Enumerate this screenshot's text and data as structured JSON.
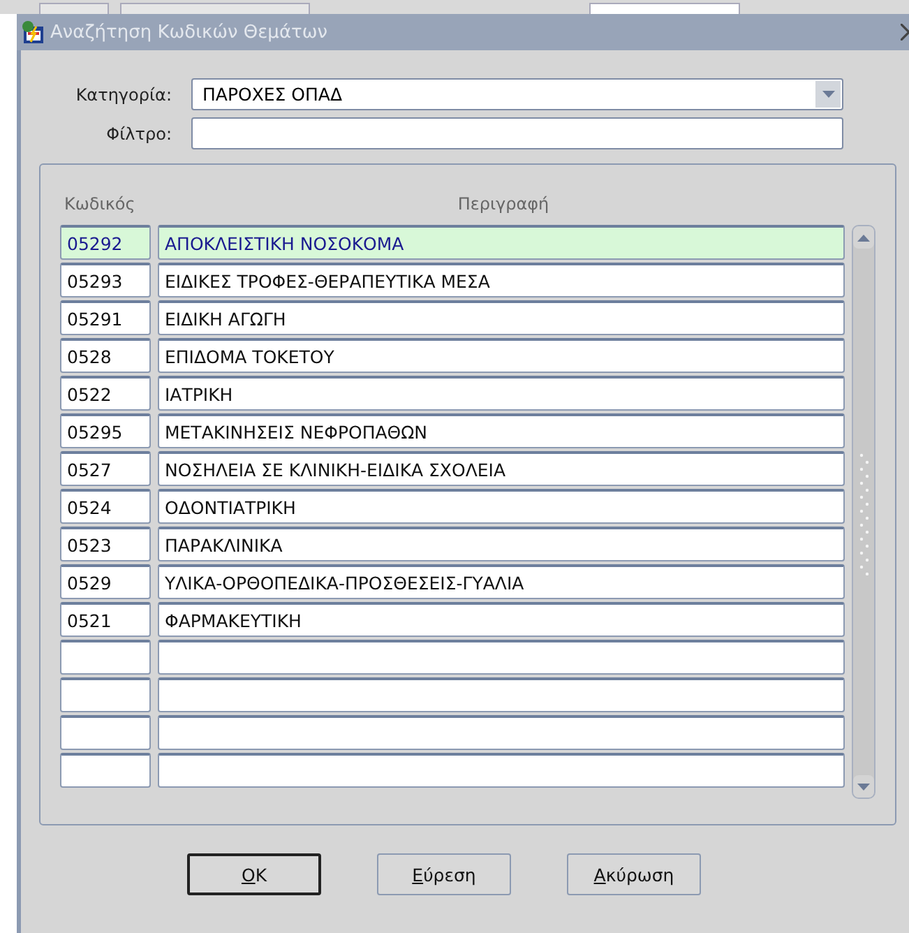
{
  "background_tabs": [
    {
      "selected": false
    },
    {
      "selected": false
    },
    {
      "selected": true
    }
  ],
  "window": {
    "title": "Αναζήτηση Κωδικών Θεμάτων"
  },
  "form": {
    "category_label": "Κατηγορία:",
    "category_value": "ΠΑΡΟΧΕΣ ΟΠΑΔ",
    "filter_label": "Φίλτρο:"
  },
  "table": {
    "columns": [
      "Κωδικός",
      "Περιγραφή"
    ],
    "rows": [
      {
        "code": "05292",
        "description": "ΑΠΟΚΛΕΙΣΤΙΚΗ ΝΟΣΟΚΟΜΑ",
        "selected": true
      },
      {
        "code": "05293",
        "description": "ΕΙΔΙΚΕΣ ΤΡΟΦΕΣ-ΘΕΡΑΠΕΥΤΙΚΑ ΜΕΣΑ",
        "selected": false
      },
      {
        "code": "05291",
        "description": "ΕΙΔΙΚΗ ΑΓΩΓΗ",
        "selected": false
      },
      {
        "code": "0528",
        "description": "ΕΠΙΔΟΜΑ ΤΟΚΕΤΟΥ",
        "selected": false
      },
      {
        "code": "0522",
        "description": "ΙΑΤΡΙΚΗ",
        "selected": false
      },
      {
        "code": "05295",
        "description": "ΜΕΤΑΚΙΝΗΣΕΙΣ ΝΕΦΡΟΠΑΘΩΝ",
        "selected": false
      },
      {
        "code": "0527",
        "description": "ΝΟΣΗΛΕΙΑ ΣΕ ΚΛΙΝΙΚΗ-ΕΙΔΙΚΑ ΣΧΟΛΕΙΑ",
        "selected": false
      },
      {
        "code": "0524",
        "description": "ΟΔΟΝΤΙΑΤΡΙΚΗ",
        "selected": false
      },
      {
        "code": "0523",
        "description": "ΠΑΡΑΚΛΙΝΙΚΑ",
        "selected": false
      },
      {
        "code": "0529",
        "description": "ΥΛΙΚΑ-ΟΡΘΟΠΕΔΙΚΑ-ΠΡΟΣΘΕΣΕΙΣ-ΓΥΑΛΙΑ",
        "selected": false
      },
      {
        "code": "0521",
        "description": "ΦΑΡΜΑΚΕΥΤΙΚΗ",
        "selected": false
      }
    ]
  },
  "buttons": [
    {
      "label": "OK",
      "default": true
    },
    {
      "label": "Εύρεση",
      "default": false
    },
    {
      "label": "Ακύρωση",
      "default": false
    }
  ]
}
